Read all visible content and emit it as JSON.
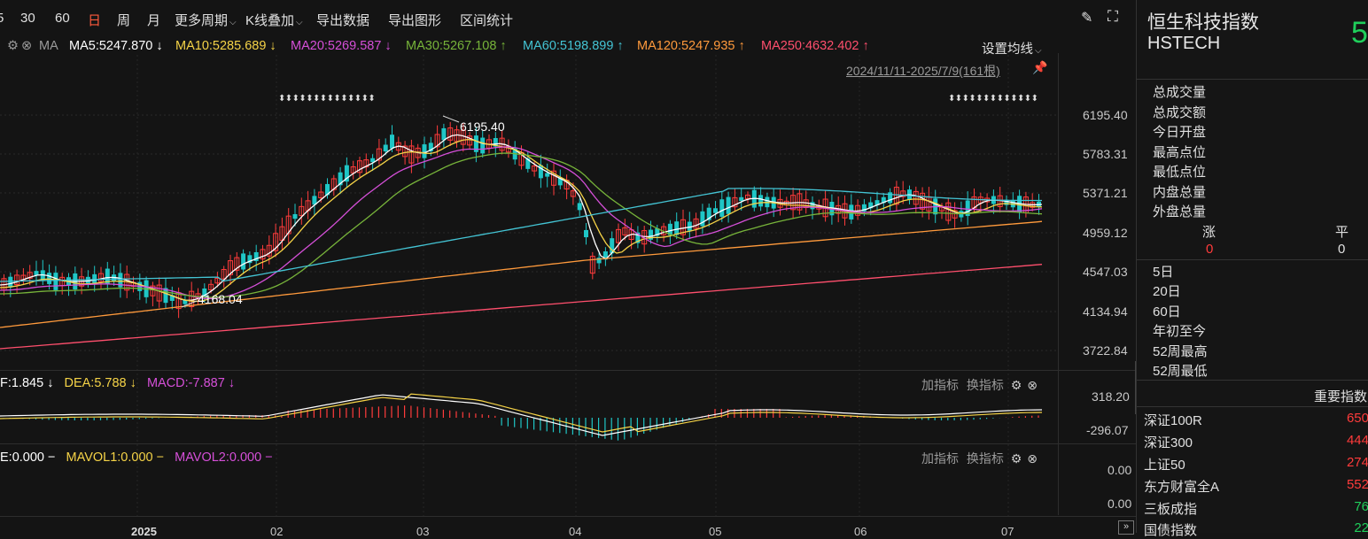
{
  "toolbar": {
    "items": [
      "5",
      "30",
      "60",
      "日",
      "周",
      "月",
      "更多周期",
      "K线叠加",
      "导出数据",
      "导出图形",
      "区间统计"
    ],
    "active_index": 3,
    "tool_icons": [
      "pen-icon",
      "fullscreen-icon"
    ]
  },
  "ma_legend": {
    "ma_label": "MA",
    "items": [
      {
        "text": "MA5:5247.870 ↓",
        "color": "#ffffff"
      },
      {
        "text": "MA10:5285.689 ↓",
        "color": "#f5d347"
      },
      {
        "text": "MA20:5269.587 ↓",
        "color": "#d54fd8"
      },
      {
        "text": "MA30:5267.108 ↑",
        "color": "#77b43a"
      },
      {
        "text": "MA60:5198.899 ↑",
        "color": "#44c4d4"
      },
      {
        "text": "MA120:5247.935 ↑",
        "color": "#ff9a3c"
      },
      {
        "text": "MA250:4632.402 ↑",
        "color": "#ff4f6d"
      }
    ],
    "settings_label": "设置均线",
    "range_label": "2024/11/11-2025/7/9(161根)"
  },
  "main_axis": {
    "labels": [
      "6195.40",
      "5783.31",
      "5371.21",
      "4959.12",
      "4547.03",
      "4134.94",
      "3722.84"
    ]
  },
  "annotations": {
    "high": "6195.40",
    "low": "4168.04"
  },
  "macd": {
    "legend": [
      {
        "text": "F:1.845 ↓",
        "color": "#ffffff"
      },
      {
        "text": "DEA:5.788 ↓",
        "color": "#f5d347"
      },
      {
        "text": "MACD:-7.887 ↓",
        "color": "#d54fd8"
      }
    ],
    "axis": [
      "318.20",
      "-296.07"
    ],
    "tools": "加指标  换指标"
  },
  "vol": {
    "legend": [
      {
        "text": "E:0.000 −",
        "color": "#ffffff"
      },
      {
        "text": "MAVOL1:0.000 −",
        "color": "#f5d347"
      },
      {
        "text": "MAVOL2:0.000 −",
        "color": "#d54fd8"
      }
    ],
    "axis": [
      "0.00",
      "0.00"
    ],
    "tools": "加指标  换指标"
  },
  "x_axis": {
    "labels": [
      "2025",
      "02",
      "03",
      "04",
      "05",
      "06",
      "07"
    ]
  },
  "right_panel": {
    "name": "恒生科技指数",
    "code": "HSTECH",
    "price_partial": "5",
    "stats": [
      "总成交量",
      "总成交额",
      "今日开盘",
      "最高点位",
      "最低点位",
      "内盘总量",
      "外盘总量"
    ],
    "rise_label": "涨",
    "flat_label": "平",
    "rise_value": "0",
    "flat_value": "0",
    "periods": [
      "5日",
      "20日",
      "60日",
      "年初至今",
      "52周最高",
      "52周最低"
    ],
    "section_title": "重要指数",
    "indices": [
      {
        "name": "深证100R",
        "value": "650",
        "color": "#ff3b3b"
      },
      {
        "name": "深证300",
        "value": "444",
        "color": "#ff3b3b"
      },
      {
        "name": "上证50",
        "value": "274",
        "color": "#ff3b3b"
      },
      {
        "name": "东方财富全A",
        "value": "552",
        "color": "#ff3b3b"
      },
      {
        "name": "三板成指",
        "value": "76",
        "color": "#1fcf5b"
      },
      {
        "name": "国债指数",
        "value": "22",
        "color": "#1fcf5b"
      }
    ]
  }
}
